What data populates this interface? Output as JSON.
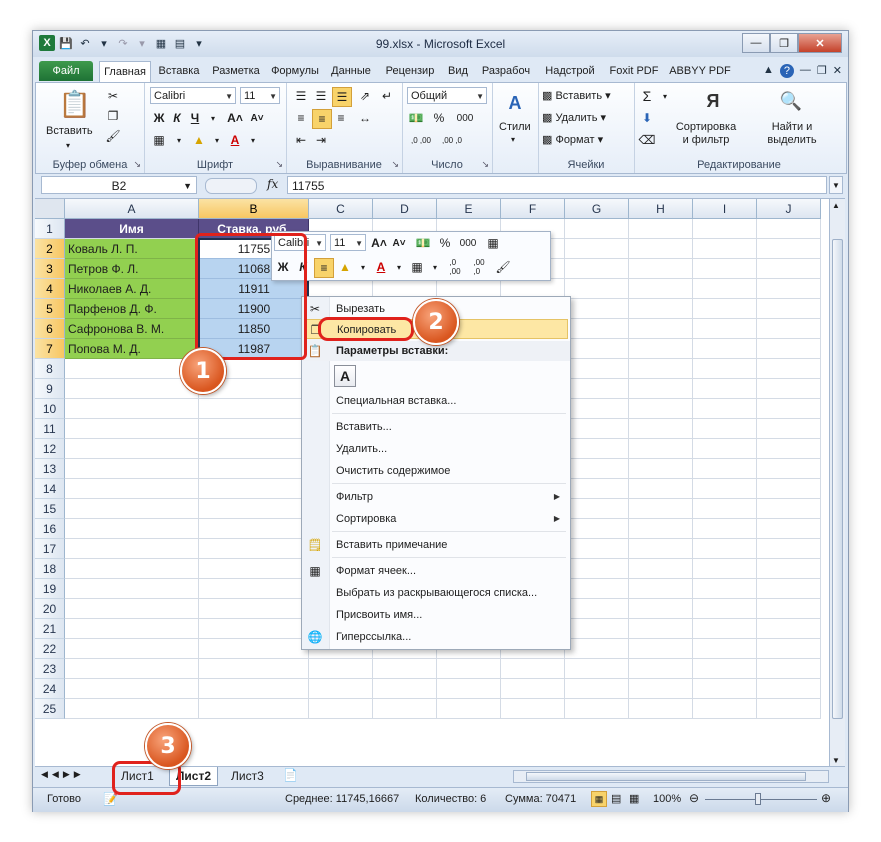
{
  "window": {
    "title": "99.xlsx - Microsoft Excel",
    "controls": [
      "minimize-icon",
      "restore-icon",
      "close-icon"
    ]
  },
  "ribbon_tabs": [
    "Файл",
    "Главная",
    "Вставка",
    "Разметка",
    "Формулы",
    "Данные",
    "Рецензир",
    "Вид",
    "Разрабоч",
    "Надстрой",
    "Foxit PDF",
    "ABBYY PDF"
  ],
  "active_tab": "Главная",
  "clipboard": {
    "paste_label": "Вставить",
    "group_label": "Буфер обмена"
  },
  "font": {
    "name": "Calibri",
    "size": "11",
    "group_label": "Шрифт",
    "bold": "Ж",
    "italic": "К",
    "underline": "Ч"
  },
  "alignment": {
    "group_label": "Выравнивание"
  },
  "number": {
    "format": "Общий",
    "group_label": "Число",
    "percent": "%",
    "thousands": "000",
    "inc": ",0 ,00",
    "dec": ",00 ,0"
  },
  "styles": {
    "label": "Стили"
  },
  "cells_group": {
    "insert": "Вставить",
    "delete": "Удалить",
    "format": "Формат",
    "group_label": "Ячейки"
  },
  "editing": {
    "sigma": "Σ",
    "sort": "Сортировка\nи фильтр",
    "find": "Найти и\nвыделить",
    "group_label": "Редактирование"
  },
  "formula_bar": {
    "cell_ref": "B2",
    "fx": "fx",
    "value": "11755"
  },
  "columns": [
    "A",
    "B",
    "C",
    "D",
    "E",
    "F",
    "G",
    "H",
    "I",
    "J"
  ],
  "rows": [
    "1",
    "2",
    "3",
    "4",
    "5",
    "6",
    "7",
    "8",
    "9",
    "10",
    "11",
    "12",
    "13",
    "14",
    "15",
    "16",
    "17",
    "18",
    "19",
    "20",
    "21",
    "22",
    "23",
    "24",
    "25"
  ],
  "table": {
    "header": [
      "Имя",
      "Ставка, руб."
    ],
    "data": [
      [
        "Коваль Л. П.",
        "11755"
      ],
      [
        "Петров Ф. Л.",
        "11068"
      ],
      [
        "Николаев А. Д.",
        "11911"
      ],
      [
        "Парфенов Д. Ф.",
        "11900"
      ],
      [
        "Сафронова В. М.",
        "11850"
      ],
      [
        "Попова М. Д.",
        "11987"
      ]
    ]
  },
  "mini_toolbar": {
    "font": "Calibri",
    "size": "11",
    "percent": "%",
    "thousands": "000"
  },
  "context_menu": {
    "cut": "Вырезать",
    "copy": "Копировать",
    "paste_options": "Параметры вставки:",
    "paste_a": "A",
    "paste_special": "Специальная вставка...",
    "insert": "Вставить...",
    "delete": "Удалить...",
    "clear": "Очистить содержимое",
    "filter": "Фильтр",
    "sort": "Сортировка",
    "insert_note": "Вставить примечание",
    "format_cells": "Формат ячеек...",
    "pick_list": "Выбрать из раскрывающегося списка...",
    "define_name": "Присвоить имя...",
    "hyperlink": "Гиперссылка..."
  },
  "sheets": [
    "Лист1",
    "Лист2",
    "Лист3"
  ],
  "active_sheet": "Лист2",
  "status": {
    "ready": "Готово",
    "average": "Среднее: 11745,16667",
    "count": "Количество: 6",
    "sum": "Сумма: 70471",
    "zoom": "100%"
  },
  "badges": [
    "1",
    "2",
    "3"
  ],
  "colors": {
    "header_fill": "#5b4e8a",
    "names_fill": "#92d050",
    "values_fill": "#b8d4f0",
    "callout": "#e0221c",
    "badge": "#e06a35"
  }
}
